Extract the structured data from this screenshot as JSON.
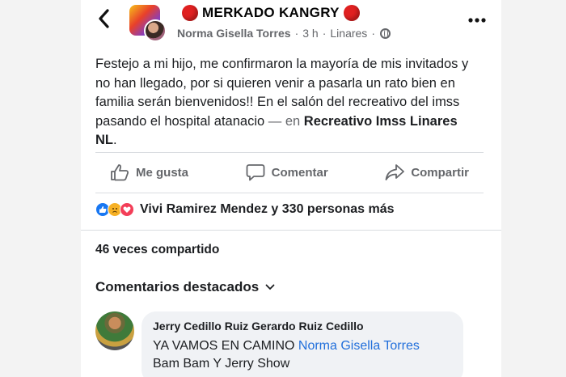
{
  "post": {
    "group_name": "MERKADO KANGRY",
    "author": "Norma Gisella Torres",
    "time": "3 h",
    "location": "Linares",
    "separator": "·",
    "text_body": "Festejo a mi hijo, me confirmaron la mayoría de mis invitados y no han llegado, por si quieren venir a pasarla un rato bien en familia serán bienvenidos!! En el salón del recreativo del imss pasando el hospital atanacio",
    "text_dash": " — en ",
    "place": "Recreativo Imss Linares NL",
    "place_suffix": "."
  },
  "actions": {
    "like": "Me gusta",
    "comment": "Comentar",
    "share": "Compartir"
  },
  "reactions": {
    "text": "Vivi Ramirez Mendez y 330 personas más",
    "types": [
      "like",
      "sad",
      "love"
    ]
  },
  "shares": {
    "text": "46 veces compartido"
  },
  "comments": {
    "header": "Comentarios destacados",
    "items": [
      {
        "author": "Jerry Cedillo Ruiz Gerardo Ruiz Cedillo",
        "text": "YA VAMOS EN CAMINO",
        "mention": "Norma Gisella Torres",
        "line2": "Bam Bam Y Jerry Show"
      }
    ]
  },
  "icons": {
    "back": "back-arrow-icon",
    "more": "more-options-icon",
    "globe": "globe-icon",
    "like": "thumbs-up-icon",
    "comment": "comment-icon",
    "share": "share-icon",
    "chevron": "chevron-down-icon"
  },
  "colors": {
    "meta_gray": "#65676b",
    "mention_blue": "#216fdb",
    "like_blue": "#1877f2",
    "love_red": "#f33e58",
    "sad_yellow": "#f7b125",
    "badge_red": "#e02020"
  }
}
